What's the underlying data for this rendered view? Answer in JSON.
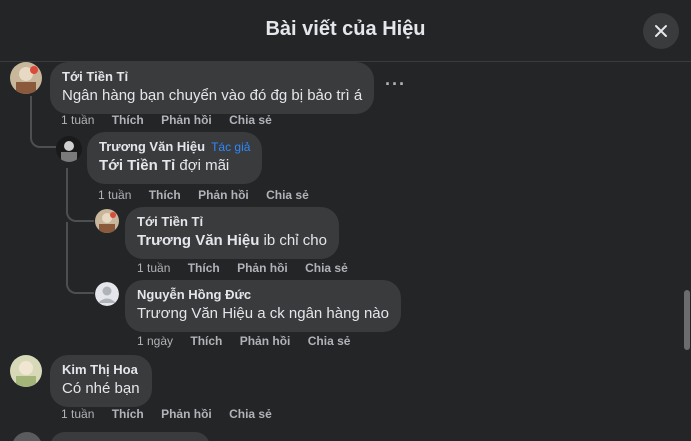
{
  "header": {
    "title": "Bài viết của Hiệu",
    "close_icon": "close-icon"
  },
  "comments": [
    {
      "author": "Tới Tiền Tỉ",
      "text": "Ngân hàng bạn chuyển vào đó đg bị bảo trì á",
      "time": "1 tuần",
      "like": "Thích",
      "reply": "Phản hồi",
      "share": "Chia sẻ",
      "more": "···"
    },
    {
      "author": "Trương Văn Hiệu",
      "tag": "Tác giả",
      "mention": "Tới Tiền Tỉ",
      "text": "đợi mãi",
      "time": "1 tuần",
      "like": "Thích",
      "reply": "Phản hồi",
      "share": "Chia sẻ"
    },
    {
      "author": "Tới Tiền Tỉ",
      "mention": "Trương Văn Hiệu",
      "text": "ib chỉ cho",
      "time": "1 tuần",
      "like": "Thích",
      "reply": "Phản hồi",
      "share": "Chia sẻ"
    },
    {
      "author": "Nguyễn Hồng Đức",
      "mention": "Trương Văn Hiệu",
      "text": "a ck ngân hàng nào",
      "time": "1 ngày",
      "like": "Thích",
      "reply": "Phản hồi",
      "share": "Chia sẻ"
    },
    {
      "author": "Kim Thị Hoa",
      "text": "Có nhé bạn",
      "time": "1 tuần",
      "like": "Thích",
      "reply": "Phản hồi",
      "share": "Chia sẻ"
    }
  ]
}
